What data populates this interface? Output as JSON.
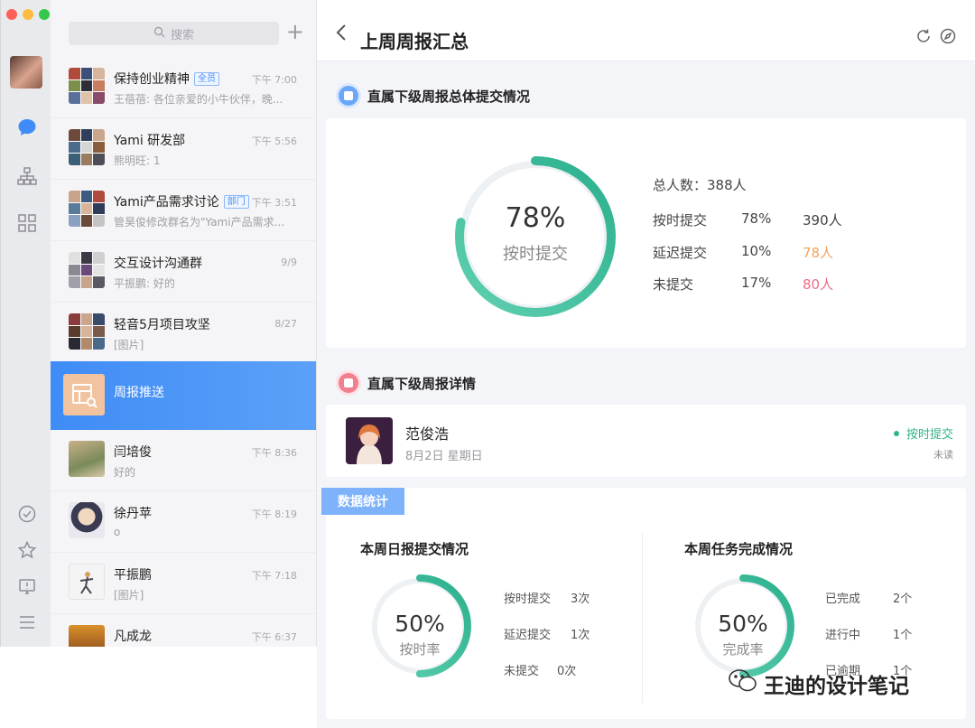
{
  "sidebar": {
    "search_placeholder": "搜索",
    "add_icon": "plus-icon",
    "nav_icons": [
      "chat-bubble-icon",
      "org-chart-icon",
      "apps-grid-icon",
      "check-circle-icon",
      "star-icon",
      "feedback-icon",
      "menu-icon"
    ]
  },
  "chats": [
    {
      "name": "保持创业精神",
      "tag": "全员",
      "msg": "王蓓蓓: 各位亲爱的小牛伙伴，晚...",
      "time": "下午 7:00"
    },
    {
      "name": "Yami 研发部",
      "tag": "",
      "msg": "熊明旺: 1",
      "time": "下午 5:56"
    },
    {
      "name": "Yami产品需求讨论",
      "tag": "部门",
      "msg": "管昊俊修改群名为\"Yami产品需求...",
      "time": "下午 3:51"
    },
    {
      "name": "交互设计沟通群",
      "tag": "",
      "msg": "平振鹏: 好的",
      "time": "9/9"
    },
    {
      "name": "轻音5月项目攻坚",
      "tag": "",
      "msg": "[图片]",
      "time": "8/27"
    },
    {
      "name": "周报推送",
      "tag": "",
      "msg": "",
      "time": ""
    },
    {
      "name": "闫培俊",
      "tag": "",
      "msg": "好的",
      "time": "下午 8:36"
    },
    {
      "name": "徐丹苹",
      "tag": "",
      "msg": "o",
      "time": "下午 8:19"
    },
    {
      "name": "平振鹏",
      "tag": "",
      "msg": "[图片]",
      "time": "下午 7:18"
    },
    {
      "name": "凡成龙",
      "tag": "",
      "msg": "",
      "time": "下午 6:37"
    }
  ],
  "header": {
    "title": "上周周报汇总",
    "back_icon": "chevron-left-icon",
    "refresh_icon": "refresh-icon",
    "compass_icon": "compass-icon"
  },
  "summary": {
    "section_title": "直属下级周报总体提交情况",
    "ring_percent": "78%",
    "ring_fraction": 0.78,
    "ring_label": "按时提交",
    "total_text": "总人数：388人",
    "rows": [
      {
        "label": "按时提交",
        "pct": "78%",
        "count": "390人",
        "color": "#444444"
      },
      {
        "label": "延迟提交",
        "pct": "10%",
        "count": "78人",
        "color": "#f5a25a"
      },
      {
        "label": "未提交",
        "pct": "17%",
        "count": "80人",
        "color": "#f06c85"
      }
    ]
  },
  "detail": {
    "section_title": "直属下级周报详情",
    "person_name": "范俊浩",
    "date": "8月2日  星期日",
    "status": "按时提交",
    "read_state": "未读"
  },
  "stats": {
    "tab_label": "数据统计",
    "daily": {
      "title": "本周日报提交情况",
      "percent": "50%",
      "fraction": 0.5,
      "label": "按时率",
      "rows": [
        {
          "label": "按时提交",
          "value": "3次"
        },
        {
          "label": "延迟提交",
          "value": "1次"
        },
        {
          "label": "未提交",
          "value": "0次"
        }
      ]
    },
    "tasks": {
      "title": "本周任务完成情况",
      "percent": "50%",
      "fraction": 0.5,
      "label": "完成率",
      "rows": [
        {
          "label": "已完成",
          "value": "2个"
        },
        {
          "label": "进行中",
          "value": "1个"
        },
        {
          "label": "已逾期",
          "value": "1个"
        }
      ]
    }
  },
  "watermark": "王迪的设计笔记",
  "colors": {
    "accent_blue": "#3f8cf6",
    "ring_green": "#3cc2a0",
    "late_orange": "#f5a25a",
    "missing_red": "#f06c85"
  }
}
